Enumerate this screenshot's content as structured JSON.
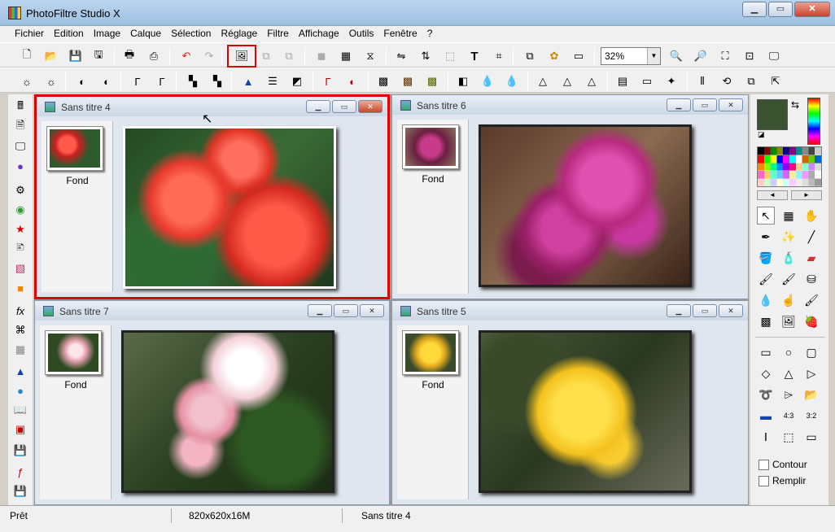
{
  "app": {
    "title": "PhotoFiltre Studio X"
  },
  "window_controls": {
    "minimize": "▁",
    "maximize": "▭",
    "close": "✕"
  },
  "menu": [
    "Fichier",
    "Edition",
    "Image",
    "Calque",
    "Sélection",
    "Réglage",
    "Filtre",
    "Affichage",
    "Outils",
    "Fenêtre",
    "?"
  ],
  "toolbar": {
    "zoom_value": "32%",
    "zoom_arrow": "▼"
  },
  "documents": [
    {
      "title": "Sans titre 4",
      "layer": "Fond"
    },
    {
      "title": "Sans titre 6",
      "layer": "Fond"
    },
    {
      "title": "Sans titre 7",
      "layer": "Fond"
    },
    {
      "title": "Sans titre 5",
      "layer": "Fond"
    }
  ],
  "status": {
    "state": "Prêt",
    "size": "820x620x16M",
    "doc": "Sans titre 4"
  },
  "options": {
    "contour": "Contour",
    "remplir": "Remplir"
  },
  "colors": {
    "foreground": "#3a5230",
    "background": "#4a3030",
    "highlight": "#e00000"
  }
}
